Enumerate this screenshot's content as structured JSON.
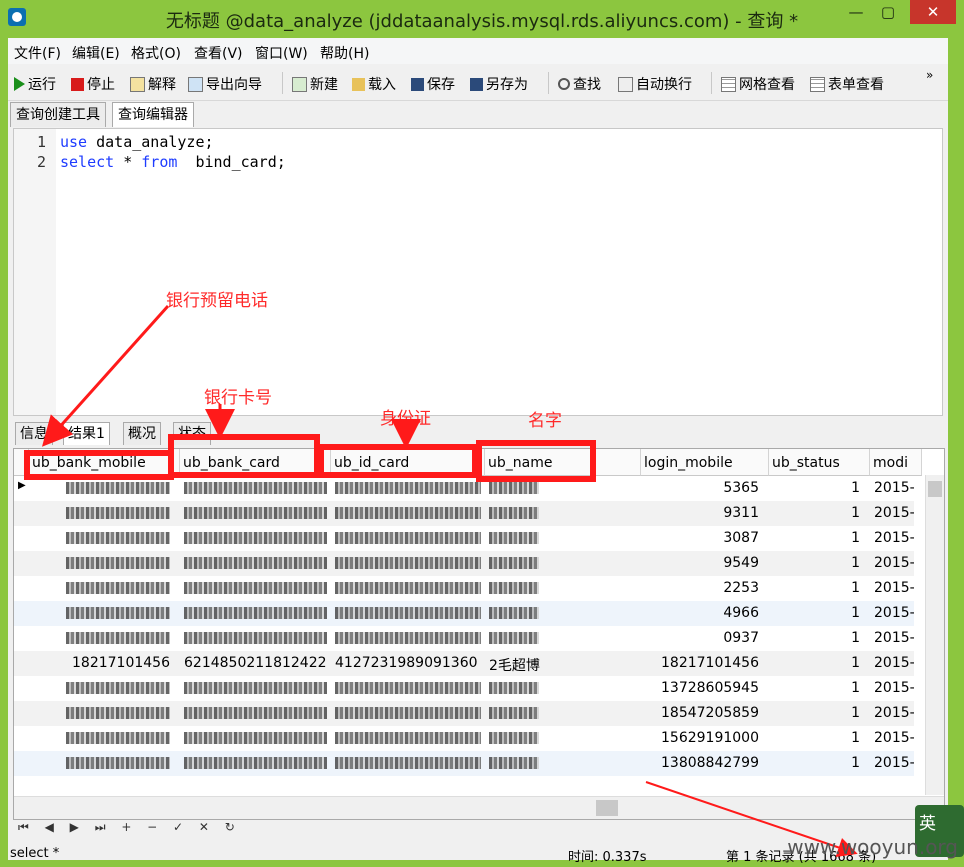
{
  "window": {
    "title": "无标题 @data_analyze (jddataanalysis.mysql.rds.aliyuncs.com) - 查询 *",
    "close": "✕",
    "minimize": "—",
    "maximize": "▢"
  },
  "menubar": [
    "文件(F)",
    "编辑(E)",
    "格式(O)",
    "查看(V)",
    "窗口(W)",
    "帮助(H)"
  ],
  "toolbar": {
    "run": "运行",
    "stop": "停止",
    "explain": "解释",
    "export": "导出向导",
    "new": "新建",
    "load": "载入",
    "save": "保存",
    "save_as": "另存为",
    "find": "查找",
    "wrap": "自动换行",
    "grid_view": "网格查看",
    "form_view": "表单查看",
    "more": "»"
  },
  "top_tabs": [
    "查询创建工具",
    "查询编辑器"
  ],
  "editor": {
    "lines": [
      {
        "num": "1",
        "kw": "use",
        "rest": " data_analyze;"
      },
      {
        "num": "2",
        "kw": "select",
        "mid": " * ",
        "kw2": "from",
        "rest": "  bind_card;"
      }
    ]
  },
  "result_tabs": [
    "信息",
    "结果1",
    "概况",
    "状态"
  ],
  "columns": [
    "ub_bank_mobile",
    "ub_bank_card",
    "ub_id_card",
    "ub_name",
    "login_mobile",
    "ub_status",
    "modi"
  ],
  "rows": [
    {
      "bank_mobile": "",
      "bank_card": "",
      "id_card": "",
      "name": "",
      "login_mobile": "5365",
      "status": "1",
      "modi": "2015-"
    },
    {
      "bank_mobile": "",
      "bank_card": "",
      "id_card": "",
      "name": "",
      "login_mobile": "9311",
      "status": "1",
      "modi": "2015-"
    },
    {
      "bank_mobile": "",
      "bank_card": "",
      "id_card": "",
      "name": "",
      "login_mobile": "3087",
      "status": "1",
      "modi": "2015-"
    },
    {
      "bank_mobile": "",
      "bank_card": "",
      "id_card": "",
      "name": "",
      "login_mobile": "9549",
      "status": "1",
      "modi": "2015-"
    },
    {
      "bank_mobile": "",
      "bank_card": "",
      "id_card": "",
      "name": "",
      "login_mobile": "2253",
      "status": "1",
      "modi": "2015-"
    },
    {
      "bank_mobile": "",
      "bank_card": "",
      "id_card": "",
      "name": "",
      "login_mobile": "4966",
      "status": "1",
      "modi": "2015-"
    },
    {
      "bank_mobile": "",
      "bank_card": "",
      "id_card": "",
      "name": "",
      "login_mobile": "0937",
      "status": "1",
      "modi": "2015-"
    },
    {
      "bank_mobile": "18217101456",
      "bank_card": "6214850211812422",
      "id_card": "4127231989091360",
      "name": "2毛超博",
      "login_mobile": "18217101456",
      "status": "1",
      "modi": "2015-"
    },
    {
      "bank_mobile": "",
      "bank_card": "",
      "id_card": "",
      "name": "",
      "login_mobile": "13728605945",
      "status": "1",
      "modi": "2015-"
    },
    {
      "bank_mobile": "",
      "bank_card": "",
      "id_card": "",
      "name": "",
      "login_mobile": "18547205859",
      "status": "1",
      "modi": "2015-"
    },
    {
      "bank_mobile": "",
      "bank_card": "",
      "id_card": "",
      "name": "",
      "login_mobile": "15629191000",
      "status": "1",
      "modi": "2015-"
    },
    {
      "bank_mobile": "",
      "bank_card": "",
      "id_card": "",
      "name": "",
      "login_mobile": "13808842799",
      "status": "1",
      "modi": "2015-"
    }
  ],
  "status": {
    "query": "select *",
    "time": "时间: 0.337s",
    "records": "第 1 条记录 (共 1668 条)"
  },
  "annotations": {
    "mobile": "银行预留电话",
    "card": "银行卡号",
    "id": "身份证",
    "name": "名字"
  },
  "watermark": "www.wooyun.org",
  "ime": "英",
  "colors": {
    "titlebar": "#8cc63f",
    "annotation": "#ff1a1a",
    "close": "#c7352b"
  }
}
